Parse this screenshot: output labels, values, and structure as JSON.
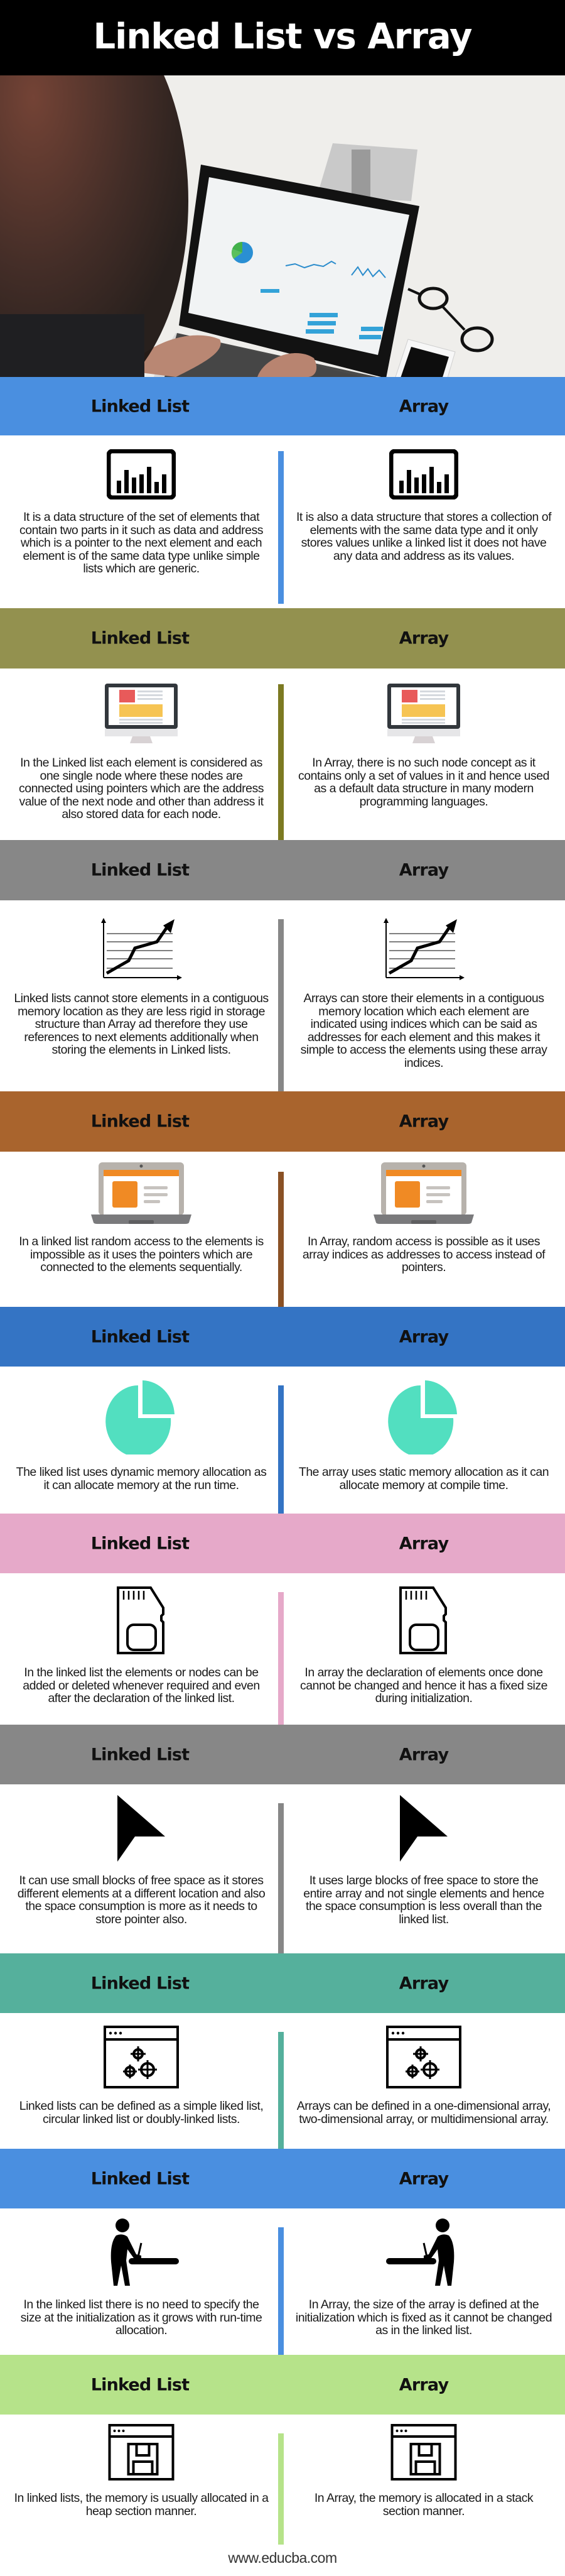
{
  "title": "Linked List vs Array",
  "photo": {
    "description": "Person typing on a laptop showing analytics dashboard, with glasses and smartphone on desk"
  },
  "column_headers": {
    "left": "Linked List",
    "right": "Array"
  },
  "sections": [
    {
      "color": "#4a8fe0",
      "icon": "bar-chart-icon",
      "left": "It is a data structure of the set of elements that contain two parts in it such as data and address which is a pointer to the next element and each element is of the same data type unlike simple lists which are generic.",
      "right": "It is also a data structure that stores a collection of elements with the same data type and it only stores values unlike a linked list it does not have any data and address as its values."
    },
    {
      "color": "#93914f",
      "divider_color": "#7c7a22",
      "icon": "monitor-icon",
      "left": "In the Linked list each element is considered as one single node where these nodes are connected using pointers which are the address value of the next node and other than address it also stored data for each node.",
      "right": "In Array, there is no such node concept as it contains only a set of values in it and hence used as a default data structure in many modern programming languages."
    },
    {
      "color": "#878787",
      "icon": "line-graph-icon",
      "left": "Linked lists cannot store elements in a contiguous memory location as they are less rigid in storage structure than Array ad therefore they use references to next elements additionally when storing the elements in Linked lists.",
      "right": "Arrays can store their elements in a contiguous memory location which each element are indicated using indices which can be said as addresses for each element and this makes it simple to access the elements using these array indices."
    },
    {
      "color": "#a9642d",
      "divider_color": "#8a5125",
      "icon": "laptop-icon",
      "left": "In a linked list random access to the elements is impossible as it uses the pointers which are connected to the elements sequentially.",
      "right": "In Array, random access is possible as it uses array indices as addresses to access instead of pointers."
    },
    {
      "color": "#3474c4",
      "icon": "pie-chart-icon",
      "left": "The liked list uses dynamic memory allocation as it can allocate memory at the run time.",
      "right": "The array uses static memory allocation as it can allocate memory at compile time."
    },
    {
      "color": "#e6a9c9",
      "icon": "sd-card-icon",
      "left": "In the linked list the elements or nodes can be added or deleted whenever required and even after the declaration of the linked list.",
      "right": "In array the declaration of elements once done cannot be changed and hence it has a fixed size during initialization."
    },
    {
      "color": "#878787",
      "icon": "cursor-arrow-icon",
      "left": "It can use small blocks of free space as it stores different elements at a different location and also the space consumption is more as it needs to store pointer also.",
      "right": "It uses large blocks of free space to store the entire array and not single elements and hence the space consumption is less overall than the linked list."
    },
    {
      "color": "#55b09c",
      "icon": "settings-window-icon",
      "left": "Linked lists can be defined as a simple liked list, circular linked list or doubly-linked lists.",
      "right": "Arrays can be defined in a one-dimensional array, two-dimensional array, or multidimensional array."
    },
    {
      "color": "#4a8fe0",
      "icon": "person-at-desk-icon",
      "left": "In the linked list there is no need to specify the size at the initialization as it grows with run-time allocation.",
      "right": "In Array, the size of the array is defined at the initialization which is fixed as it cannot be changed as in the linked list."
    },
    {
      "color": "#b6e38a",
      "icon": "floppy-window-icon",
      "left": "In linked lists, the memory is usually allocated in a heap section manner.",
      "right": "In Array, the memory is allocated in a stack section manner."
    }
  ],
  "footer": "www.educba.com"
}
